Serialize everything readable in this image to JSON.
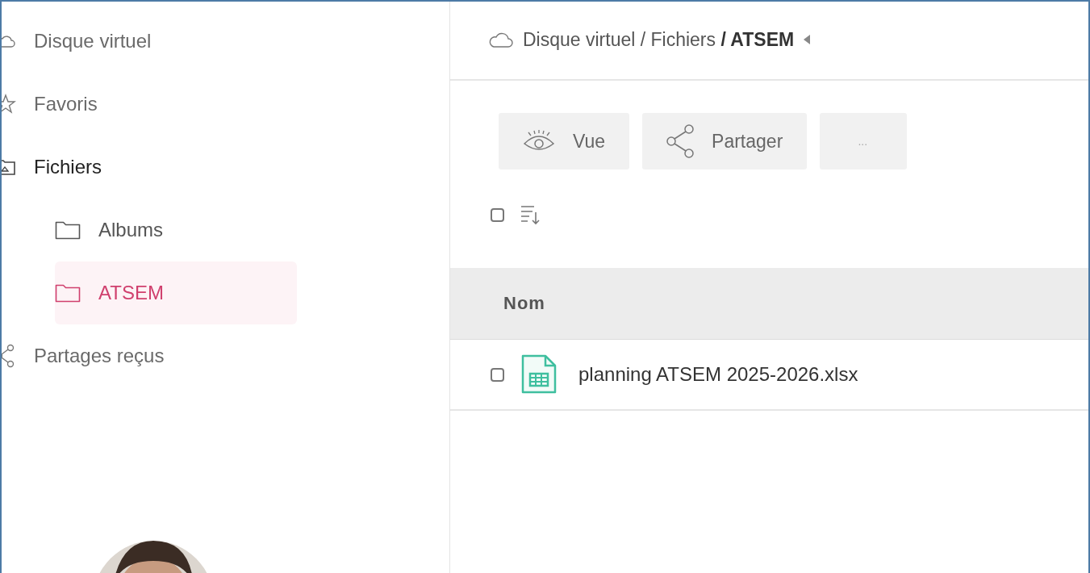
{
  "sidebar": {
    "items": [
      {
        "label": "Disque virtuel",
        "kind": "drive",
        "selected": false
      },
      {
        "label": "Favoris",
        "kind": "favorites",
        "selected": false
      },
      {
        "label": "Fichiers",
        "kind": "files",
        "selected": false,
        "children": [
          {
            "label": "Albums",
            "kind": "folder",
            "selected": false
          },
          {
            "label": "ATSEM",
            "kind": "folder",
            "selected": true
          }
        ]
      },
      {
        "label": "Partages reçus",
        "kind": "shared",
        "selected": false
      }
    ]
  },
  "breadcrumb": {
    "path": "Disque virtuel / Fichiers **/ ATSEM**"
  },
  "toolbar": {
    "buttons": [
      {
        "label": "Vue",
        "kind": "view"
      },
      {
        "label": "Partager",
        "kind": "share"
      },
      {
        "label": "...",
        "kind": "more"
      }
    ]
  },
  "select_all": {
    "checked": false
  },
  "table": {
    "columns": [
      "Nom"
    ],
    "rows": [
      {
        "name": "planning ATSEM 2025-2026.xlsx",
        "kind": "spreadsheet",
        "checked": false
      }
    ]
  }
}
